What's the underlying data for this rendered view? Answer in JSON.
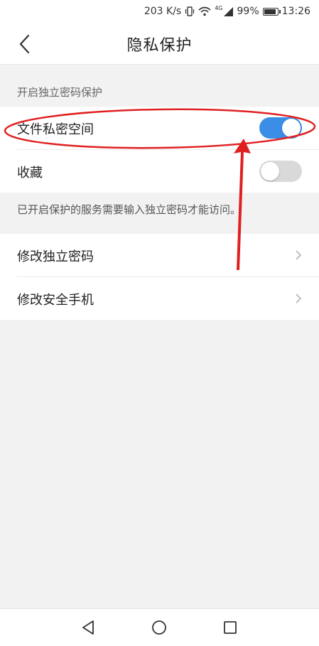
{
  "status_bar": {
    "speed": "203 K/s",
    "network": "4G",
    "battery": "99%",
    "battery_level": 0.99,
    "time": "13:26"
  },
  "header": {
    "title": "隐私保护",
    "back_icon": "chevron-left-icon"
  },
  "section": {
    "header": "开启独立密码保护"
  },
  "toggles": [
    {
      "label": "文件私密空间",
      "on": true
    },
    {
      "label": "收藏",
      "on": false
    }
  ],
  "note": "已开启保护的服务需要输入独立密码才能访问。",
  "menu": [
    {
      "label": "修改独立密码",
      "icon": "chevron-right-icon"
    },
    {
      "label": "修改安全手机",
      "icon": "chevron-right-icon"
    }
  ],
  "nav": {
    "back_icon": "triangle-back-icon",
    "home_icon": "circle-home-icon",
    "recent_icon": "square-recent-icon"
  },
  "colors": {
    "toggle_on": "#3a8ee6",
    "toggle_off": "#d9d9d9",
    "annotation": "#e02020",
    "background": "#f2f2f2"
  }
}
